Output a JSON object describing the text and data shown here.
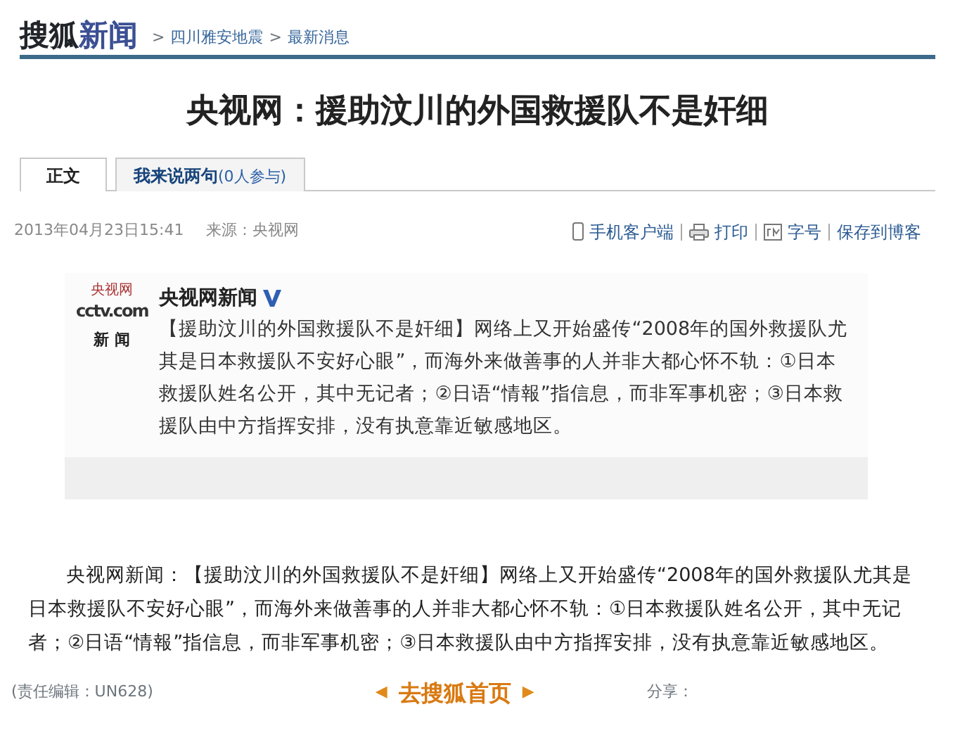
{
  "header": {
    "logo_dark": "搜狐",
    "logo_blue": "新闻",
    "breadcrumbs": [
      {
        "sep": ">",
        "label": "四川雅安地震"
      },
      {
        "sep": ">",
        "label": "最新消息"
      }
    ]
  },
  "title": "央视网：援助汶川的外国救援队不是奸细",
  "tabs": [
    {
      "label": "正文",
      "selected": true
    },
    {
      "label": "我来说两句",
      "count": "(0人参与)",
      "selected": false
    }
  ],
  "meta": {
    "time": "2013年04月23日15:41",
    "source": "来源：央视网",
    "actions": [
      {
        "kind": "phone",
        "label": "手机客户端"
      },
      {
        "kind": "print",
        "label": "打印"
      },
      {
        "kind": "font",
        "label": "字号"
      },
      {
        "kind": "none",
        "label": "保存到博客"
      }
    ]
  },
  "weibo": {
    "logo_top": "央视网",
    "logo_cctv": "cctv.com",
    "logo_bottom": "新 闻",
    "author": "央视网新闻",
    "verified": true,
    "text": "【援助汶川的外国救援队不是奸细】网络上又开始盛传“2008年的国外救援队尤其是日本救援队不安好心眼”，而海外来做善事的人并非大都心怀不轨：①日本救援队姓名公开，其中无记者；②日语“情報”指信息，而非军事机密；③日本救援队由中方指挥安排，没有执意靠近敏感地区。"
  },
  "body": "央视网新闻：【援助汶川的外国救援队不是奸细】网络上又开始盛传“2008年的国外救援队尤其是日本救援队不安好心眼”，而海外来做善事的人并非大都心怀不轨：①日本救援队姓名公开，其中无记者；②日语“情報”指信息，而非军事机密；③日本救援队由中方指挥安排，没有执意靠近敏感地区。",
  "footer": {
    "editor": "(责任编辑：UN628)",
    "prev": "◀",
    "home": "去搜狐首页",
    "next": "▶",
    "share": "分享："
  }
}
